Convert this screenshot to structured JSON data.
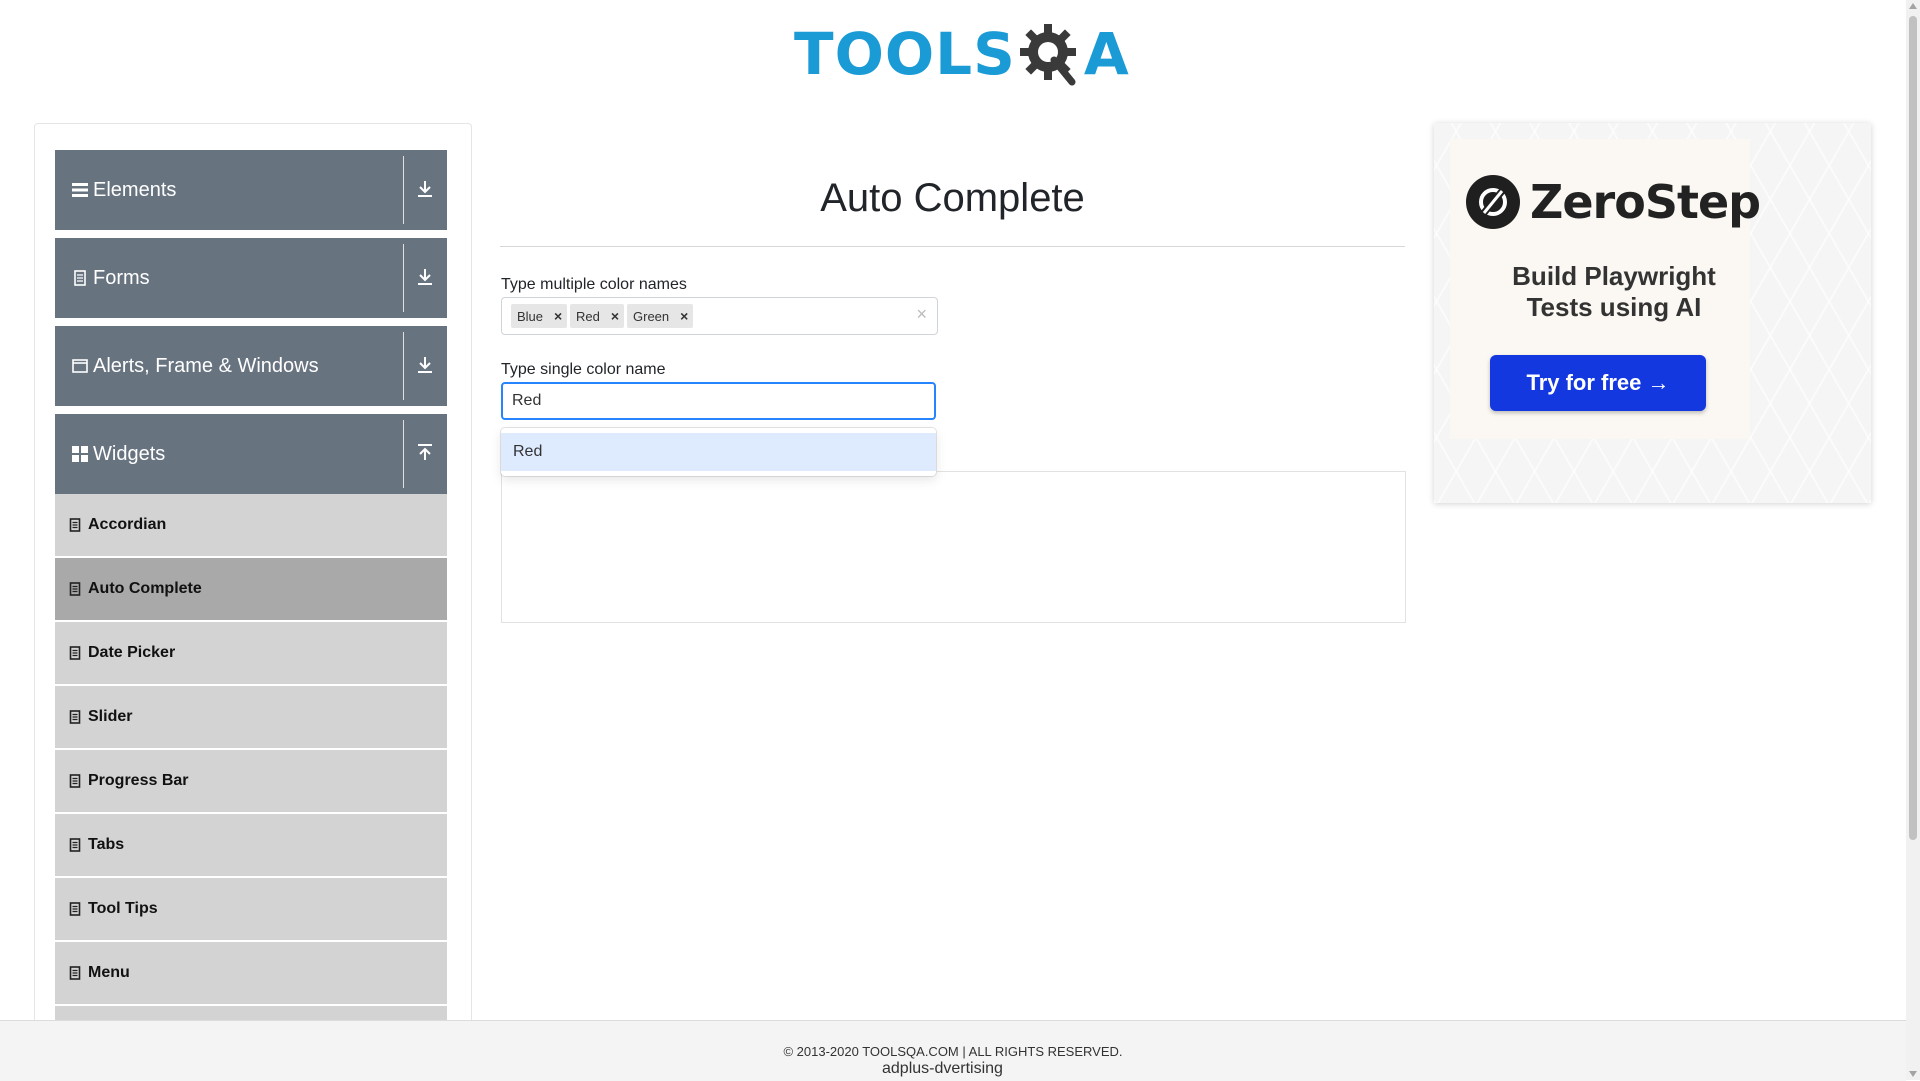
{
  "header": {
    "logo_part1": "TOOLS",
    "logo_part2": "A",
    "logo_icon": "gear-q-icon",
    "brand_color_blue": "#1b9bd6",
    "brand_color_dark": "#3a3a3a"
  },
  "sidebar": {
    "groups": [
      {
        "label": "Elements",
        "icon": "hamburger-icon",
        "arrow": "download-arrow-icon"
      },
      {
        "label": "Forms",
        "icon": "document-icon",
        "arrow": "download-arrow-icon"
      },
      {
        "label": "Alerts, Frame & Windows",
        "icon": "window-icon",
        "arrow": "download-arrow-icon"
      },
      {
        "label": "Widgets",
        "icon": "grid-icon",
        "arrow": "upload-arrow-icon"
      }
    ],
    "items": [
      {
        "label": "Accordian",
        "active": false
      },
      {
        "label": "Auto Complete",
        "active": true
      },
      {
        "label": "Date Picker",
        "active": false
      },
      {
        "label": "Slider",
        "active": false
      },
      {
        "label": "Progress Bar",
        "active": false
      },
      {
        "label": "Tabs",
        "active": false
      },
      {
        "label": "Tool Tips",
        "active": false
      },
      {
        "label": "Menu",
        "active": false
      }
    ],
    "header_color": "#687380",
    "item_color": "#d3d3d3",
    "active_color": "#a9a9a9"
  },
  "main": {
    "title": "Auto Complete",
    "multi": {
      "label": "Type multiple color names",
      "chips": [
        "Blue",
        "Red",
        "Green"
      ],
      "chip_remove": "×",
      "clear": "×"
    },
    "single": {
      "label": "Type single color name",
      "value": "Red",
      "focus_color": "#2684ff"
    },
    "dropdown": {
      "options": [
        "Red"
      ],
      "highlight_color": "#deebff"
    }
  },
  "ad": {
    "brand": "ZeroStep",
    "tagline_line1": "Build Playwright",
    "tagline_line2": "Tests using AI",
    "cta": "Try for free →",
    "cta_color": "#1438e0"
  },
  "footer": {
    "copyright": "© 2013-2020 TOOLSQA.COM | ALL RIGHTS RESERVED.",
    "ad_alt": "adplus-dvertising"
  }
}
